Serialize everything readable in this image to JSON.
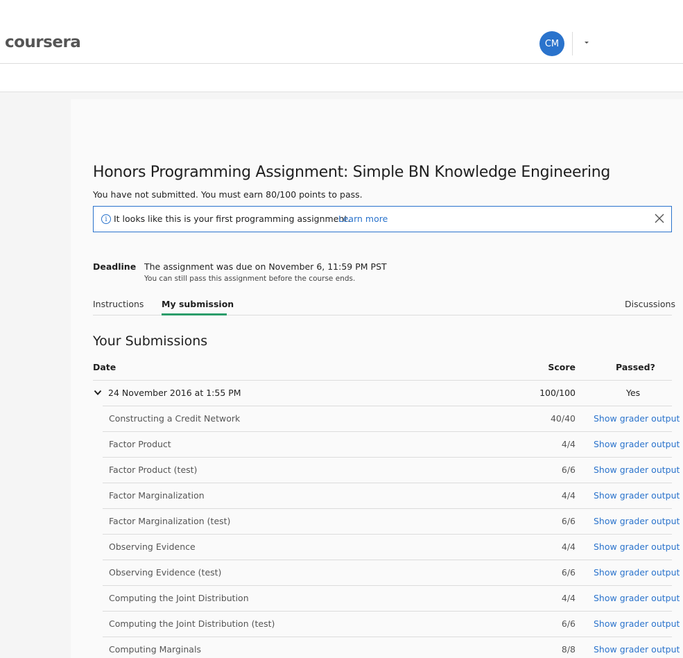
{
  "header": {
    "logo_text": "coursera",
    "avatar_initials": "CM"
  },
  "assignment": {
    "title": "Honors Programming Assignment: Simple BN Knowledge Engineering",
    "status_text": "You have not submitted. You must earn 80/100 points to pass."
  },
  "notice": {
    "message": "It looks like this is your first programming assignment.",
    "learn_more": "Learn more"
  },
  "deadline": {
    "label": "Deadline",
    "text": "The assignment was due on November 6, 11:59 PM PST",
    "subtext": "You can still pass this assignment before the course ends."
  },
  "tabs": {
    "instructions": "Instructions",
    "my_submission": "My submission",
    "discussions": "Discussions"
  },
  "submissions": {
    "section_title": "Your Submissions",
    "columns": {
      "date": "Date",
      "score": "Score",
      "passed": "Passed?"
    },
    "entry": {
      "date": "24 November 2016 at 1:55 PM",
      "score": "100/100",
      "passed": "Yes"
    },
    "parts": [
      {
        "name": "Constructing a Credit Network",
        "score": "40/40",
        "link": "Show grader output"
      },
      {
        "name": "Factor Product",
        "score": "4/4",
        "link": "Show grader output"
      },
      {
        "name": "Factor Product (test)",
        "score": "6/6",
        "link": "Show grader output"
      },
      {
        "name": "Factor Marginalization",
        "score": "4/4",
        "link": "Show grader output"
      },
      {
        "name": "Factor Marginalization (test)",
        "score": "6/6",
        "link": "Show grader output"
      },
      {
        "name": "Observing Evidence",
        "score": "4/4",
        "link": "Show grader output"
      },
      {
        "name": "Observing Evidence (test)",
        "score": "6/6",
        "link": "Show grader output"
      },
      {
        "name": "Computing the Joint Distribution",
        "score": "4/4",
        "link": "Show grader output"
      },
      {
        "name": "Computing the Joint Distribution (test)",
        "score": "6/6",
        "link": "Show grader output"
      },
      {
        "name": "Computing Marginals",
        "score": "8/8",
        "link": "Show grader output"
      }
    ]
  },
  "colors": {
    "accent": "#2a73cc",
    "tab_underline": "#2a9d6a"
  }
}
